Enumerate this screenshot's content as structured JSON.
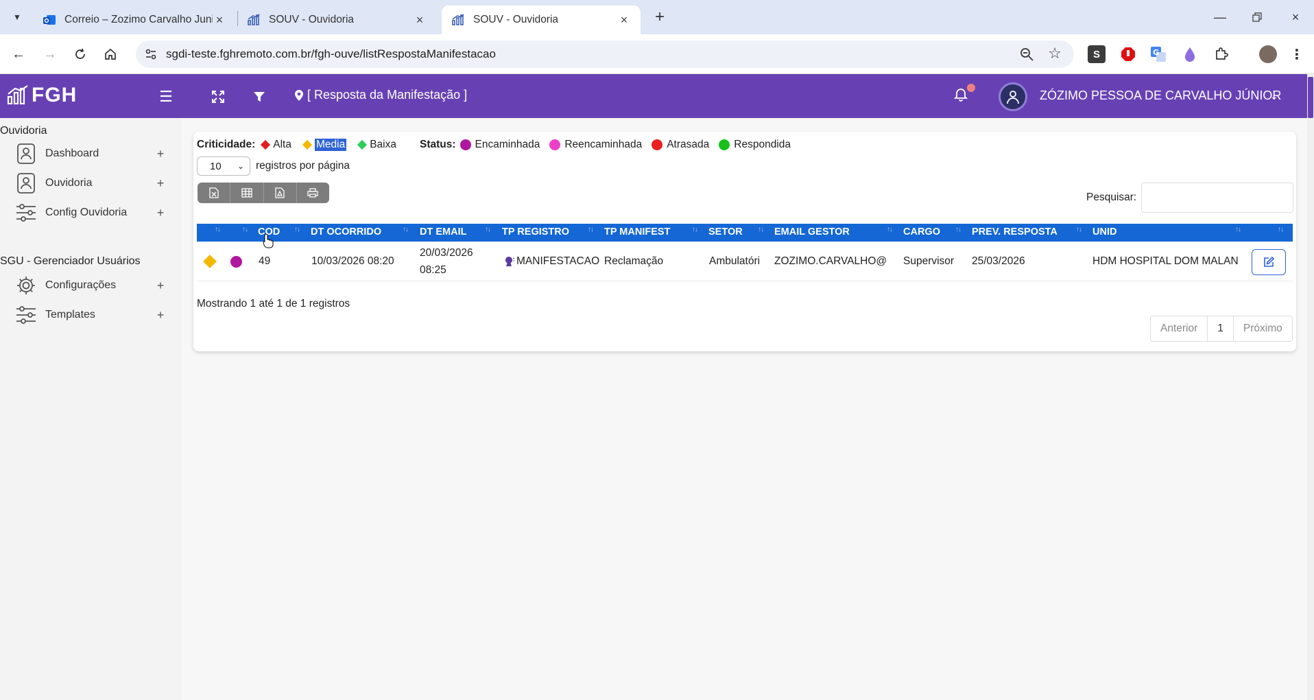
{
  "browser": {
    "tabs": [
      {
        "title": "Correio – Zozimo Carvalho Juni",
        "icon": "outlook-icon"
      },
      {
        "title": "SOUV - Ouvidoria",
        "icon": "chart-icon"
      },
      {
        "title": "SOUV - Ouvidoria",
        "icon": "chart-icon"
      }
    ],
    "url": "sgdi-teste.fghremoto.com.br/fgh-ouve/listRespostaManifestacao"
  },
  "header": {
    "logo": "FGH",
    "breadcrumb": "[ Resposta da Manifestação ]",
    "user": "ZÓZIMO PESSOA DE CARVALHO JÚNIOR",
    "brand_color": "#6741b4"
  },
  "sidebar": {
    "sections": [
      {
        "title": "Ouvidoria",
        "items": [
          {
            "label": "Dashboard",
            "icon": "user-card-icon"
          },
          {
            "label": "Ouvidoria",
            "icon": "user-card-icon"
          },
          {
            "label": "Config Ouvidoria",
            "icon": "sliders-icon"
          }
        ]
      },
      {
        "title": "SGU - Gerenciador Usuários",
        "items": [
          {
            "label": "Configurações",
            "icon": "gear-icon"
          },
          {
            "label": "Templates",
            "icon": "sliders-icon"
          }
        ]
      }
    ]
  },
  "legend": {
    "criticidade_label": "Criticidade:",
    "criticidade": [
      {
        "label": "Alta",
        "color": "#e02020"
      },
      {
        "label": "Media",
        "color": "#f5b800"
      },
      {
        "label": "Baixa",
        "color": "#2ecc5a"
      }
    ],
    "status_label": "Status:",
    "status": [
      {
        "label": "Encaminhada",
        "color": "#b0169e"
      },
      {
        "label": "Reencaminhada",
        "color": "#ee3fc8"
      },
      {
        "label": "Atrasada",
        "color": "#e82020"
      },
      {
        "label": "Respondida",
        "color": "#19c019"
      }
    ]
  },
  "controls": {
    "per_page_value": "10",
    "per_page_label": "registros por página",
    "search_label": "Pesquisar:",
    "search_value": ""
  },
  "table": {
    "columns": [
      "COD",
      "DT OCORRIDO",
      "DT EMAIL",
      "TP REGISTRO",
      "TP MANIFEST",
      "SETOR",
      "EMAIL GESTOR",
      "CARGO",
      "PREV. RESPOSTA",
      "UNID"
    ],
    "rows": [
      {
        "cod": "49",
        "dt_ocorrido": "10/03/2026 08:20",
        "dt_email_date": "20/03/2026",
        "dt_email_time": "08:25",
        "tp_registro": "MANIFESTACAO",
        "tp_manifest": "Reclamação",
        "setor": "Ambulatóri",
        "email_gestor": "ZOZIMO.CARVALHO@",
        "cargo": "Supervisor",
        "prev_resposta": "25/03/2026",
        "unid": "HDM HOSPITAL DOM MALAN"
      }
    ]
  },
  "footer": {
    "info": "Mostrando 1 até 1 de 1 registros",
    "prev": "Anterior",
    "page": "1",
    "next": "Próximo"
  }
}
